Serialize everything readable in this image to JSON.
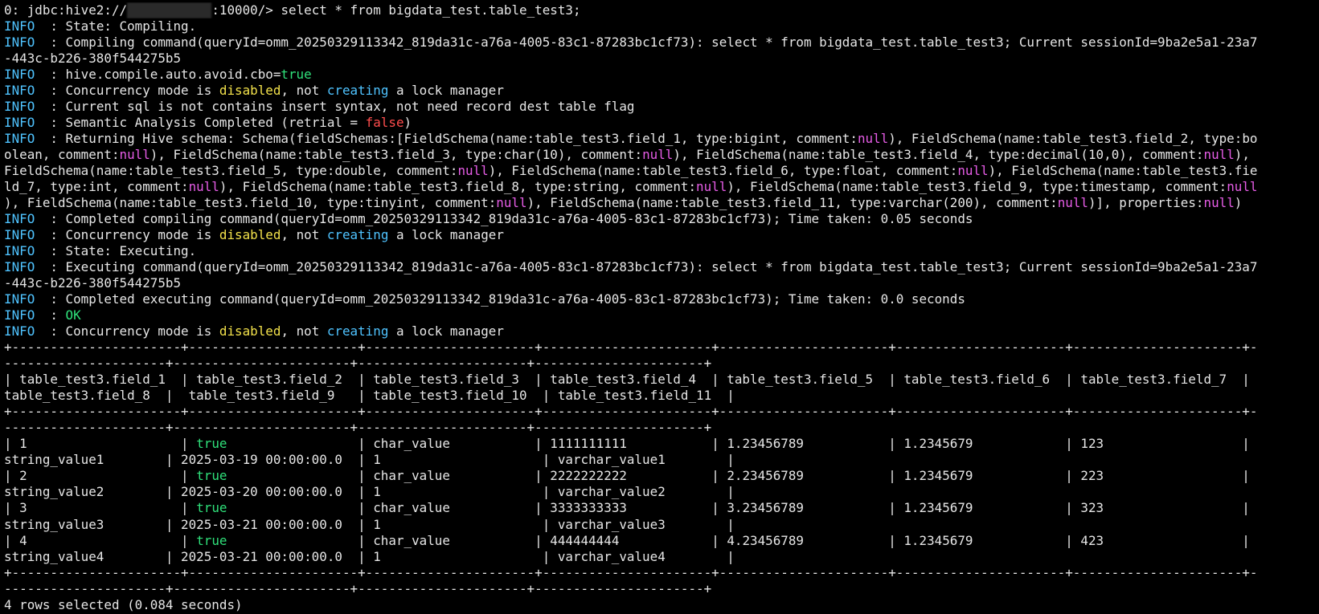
{
  "colors": {
    "background": "#000000",
    "text": "#e6e6e6",
    "info_tag": "#4fc3ff",
    "true": "#2fe07a",
    "disabled": "#f2e14b",
    "null": "#e65ce6",
    "false": "#ff4d4d",
    "underline": "#d01414"
  },
  "lines": [
    [
      {
        "t": "0: jdbc:hive2://"
      },
      {
        "t": "1xxxxxxxxx1",
        "c": "masked"
      },
      {
        "t": ":10000/> "
      },
      {
        "t": "select * from bigdata_test.table_test3;",
        "c": "prompt-cmd"
      }
    ],
    [
      {
        "t": "INFO ",
        "c": "c-info"
      },
      {
        "t": " : State: Compiling."
      }
    ],
    [
      {
        "t": "INFO ",
        "c": "c-info"
      },
      {
        "t": " : Compiling command(queryId=omm_20250329113342_819da31c-a76a-4005-83c1-87283bc1cf73): select * from bigdata_test.table_test3; Current sessionId=9ba2e5a1-23a7"
      }
    ],
    [
      {
        "t": "-443c-b226-380f544275b5"
      }
    ],
    [
      {
        "t": "INFO ",
        "c": "c-info"
      },
      {
        "t": " : hive.compile.auto.avoid.cbo="
      },
      {
        "t": "true",
        "c": "c-green"
      }
    ],
    [
      {
        "t": "INFO ",
        "c": "c-info"
      },
      {
        "t": " : Concurrency mode is "
      },
      {
        "t": "disabled",
        "c": "c-yellow"
      },
      {
        "t": ", not "
      },
      {
        "t": "creating",
        "c": "c-cyan"
      },
      {
        "t": " a lock manager"
      }
    ],
    [
      {
        "t": "INFO ",
        "c": "c-info"
      },
      {
        "t": " : Current sql is not contains insert syntax, not need record dest table flag"
      }
    ],
    [
      {
        "t": "INFO ",
        "c": "c-info"
      },
      {
        "t": " : Semantic Analysis Completed (retrial = "
      },
      {
        "t": "false",
        "c": "c-red"
      },
      {
        "t": ")"
      }
    ],
    [
      {
        "t": "INFO ",
        "c": "c-info"
      },
      {
        "t": " : Returning Hive schema: Schema(fieldSchemas:[FieldSchema(name:table_test3.field_1, type:bigint, comment:"
      },
      {
        "t": "null",
        "c": "c-magenta"
      },
      {
        "t": "), FieldSchema(name:table_test3.field_2, type:bo"
      }
    ],
    [
      {
        "t": "olean, comment:"
      },
      {
        "t": "null",
        "c": "c-magenta"
      },
      {
        "t": "), FieldSchema(name:table_test3.field_3, type:char(10), comment:"
      },
      {
        "t": "null",
        "c": "c-magenta"
      },
      {
        "t": "), FieldSchema(name:table_test3.field_4, type:decimal(10,0), comment:"
      },
      {
        "t": "null",
        "c": "c-magenta"
      },
      {
        "t": "),"
      }
    ],
    [
      {
        "t": "FieldSchema(name:table_test3.field_5, type:double, comment:"
      },
      {
        "t": "null",
        "c": "c-magenta"
      },
      {
        "t": "), FieldSchema(name:table_test3.field_6, type:float, comment:"
      },
      {
        "t": "null",
        "c": "c-magenta"
      },
      {
        "t": "), FieldSchema(name:table_test3.fie"
      }
    ],
    [
      {
        "t": "ld_7, type:int, comment:"
      },
      {
        "t": "null",
        "c": "c-magenta"
      },
      {
        "t": "), FieldSchema(name:table_test3.field_8, type:string, comment:"
      },
      {
        "t": "null",
        "c": "c-magenta"
      },
      {
        "t": "), FieldSchema(name:table_test3.field_9, type:timestamp, comment:"
      },
      {
        "t": "null",
        "c": "c-magenta"
      }
    ],
    [
      {
        "t": "), FieldSchema(name:table_test3.field_10, type:tinyint, comment:"
      },
      {
        "t": "null",
        "c": "c-magenta"
      },
      {
        "t": "), FieldSchema(name:table_test3.field_11, type:varchar(200), comment:"
      },
      {
        "t": "null",
        "c": "c-magenta"
      },
      {
        "t": ")], properties:"
      },
      {
        "t": "null",
        "c": "c-magenta"
      },
      {
        "t": ")"
      }
    ],
    [
      {
        "t": "INFO ",
        "c": "c-info"
      },
      {
        "t": " : Completed compiling command(queryId=omm_20250329113342_819da31c-a76a-4005-83c1-87283bc1cf73); Time taken: 0.05 seconds"
      }
    ],
    [
      {
        "t": "INFO ",
        "c": "c-info"
      },
      {
        "t": " : Concurrency mode is "
      },
      {
        "t": "disabled",
        "c": "c-yellow"
      },
      {
        "t": ", not "
      },
      {
        "t": "creating",
        "c": "c-cyan"
      },
      {
        "t": " a lock manager"
      }
    ],
    [
      {
        "t": "INFO ",
        "c": "c-info"
      },
      {
        "t": " : State: Executing."
      }
    ],
    [
      {
        "t": "INFO ",
        "c": "c-info"
      },
      {
        "t": " : Executing command(queryId=omm_20250329113342_819da31c-a76a-4005-83c1-87283bc1cf73): select * from bigdata_test.table_test3; Current sessionId=9ba2e5a1-23a7"
      }
    ],
    [
      {
        "t": "-443c-b226-380f544275b5"
      }
    ],
    [
      {
        "t": "INFO ",
        "c": "c-info"
      },
      {
        "t": " : Completed executing command(queryId=omm_20250329113342_819da31c-a76a-4005-83c1-87283bc1cf73); Time taken: 0.0 seconds"
      }
    ],
    [
      {
        "t": "INFO ",
        "c": "c-info"
      },
      {
        "t": " : "
      },
      {
        "t": "OK",
        "c": "c-green"
      }
    ],
    [
      {
        "t": "INFO ",
        "c": "c-info"
      },
      {
        "t": " : Concurrency mode is "
      },
      {
        "t": "disabled",
        "c": "c-yellow"
      },
      {
        "t": ", not "
      },
      {
        "t": "creating",
        "c": "c-cyan"
      },
      {
        "t": " a lock manager"
      }
    ],
    [
      {
        "t": "+----------------------+----------------------+----------------------+----------------------+----------------------+----------------------+----------------------+-"
      }
    ],
    [
      {
        "t": "---------------------+-----------------------+----------------------+----------------------+"
      }
    ],
    [
      {
        "t": "| table_test3.field_1  | table_test3.field_2  | table_test3.field_3  | table_test3.field_4  | table_test3.field_5  | table_test3.field_6  | table_test3.field_7  |"
      }
    ],
    [
      {
        "t": "table_test3.field_8  |  table_test3.field_9   | table_test3.field_10  | table_test3.field_11  |"
      }
    ],
    [
      {
        "t": "+----------------------+----------------------+----------------------+----------------------+----------------------+----------------------+----------------------+-"
      }
    ],
    [
      {
        "t": "---------------------+-----------------------+----------------------+----------------------+"
      }
    ],
    [
      {
        "t": "| 1                    | "
      },
      {
        "t": "true",
        "c": "c-green"
      },
      {
        "t": "                 | char_value           | 1111111111           | 1.23456789           | 1.2345679            | 123                  |"
      }
    ],
    [
      {
        "t": "string_value1        | 2025-03-19 00:00:00.0  | 1                     | varchar_value1        |"
      }
    ],
    [
      {
        "t": "| 2                    | "
      },
      {
        "t": "true",
        "c": "c-green"
      },
      {
        "t": "                 | char_value           | 2222222222           | 2.23456789           | 1.2345679            | 223                  |"
      }
    ],
    [
      {
        "t": "string_value2        | 2025-03-20 00:00:00.0  | 1                     | varchar_value2        |"
      }
    ],
    [
      {
        "t": "| 3                    | "
      },
      {
        "t": "true",
        "c": "c-green"
      },
      {
        "t": "                 | char_value           | 3333333333           | 3.23456789           | 1.2345679            | 323                  |"
      }
    ],
    [
      {
        "t": "string_value3        | 2025-03-21 00:00:00.0  | 1                     | varchar_value3        |"
      }
    ],
    [
      {
        "t": "| 4                    | "
      },
      {
        "t": "true",
        "c": "c-green"
      },
      {
        "t": "                 | char_value           | 444444444            | 4.23456789           | 1.2345679            | 423                  |"
      }
    ],
    [
      {
        "t": "string_value4        | 2025-03-21 00:00:00.0  | 1                     | varchar_value4        |"
      }
    ],
    [
      {
        "t": "+----------------------+----------------------+----------------------+----------------------+----------------------+----------------------+----------------------+-"
      }
    ],
    [
      {
        "t": "---------------------+-----------------------+----------------------+----------------------+"
      }
    ],
    [
      {
        "t": "4 rows selected (0.084 seconds)"
      }
    ],
    [
      {
        "t": "                   "
      },
      {
        "t": "_",
        "c": "cursor-char"
      }
    ]
  ]
}
